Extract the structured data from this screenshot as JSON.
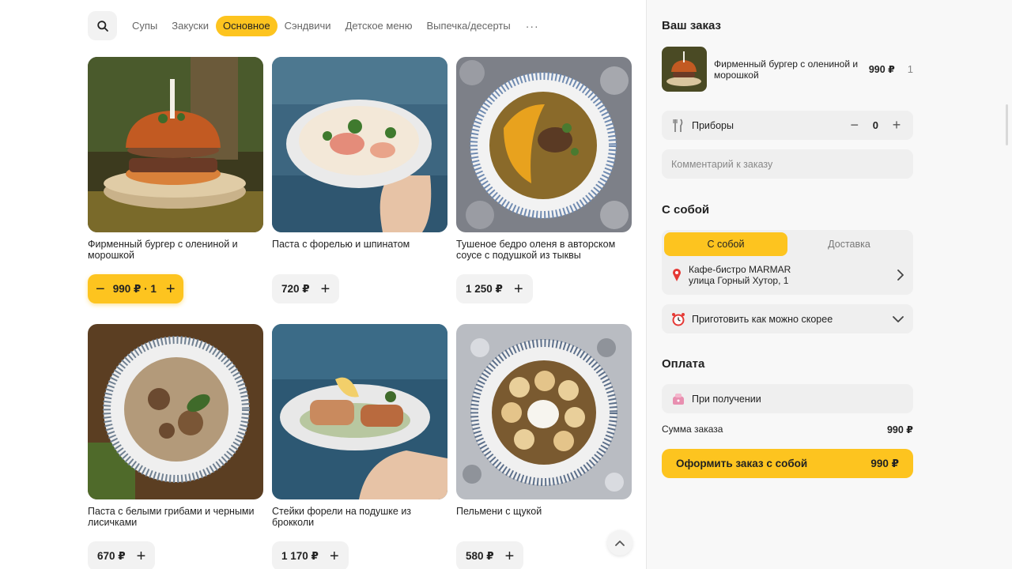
{
  "menu": {
    "categories": [
      "Супы",
      "Закуски",
      "Основное",
      "Сэндвичи",
      "Детское меню",
      "Выпечка/десерты"
    ],
    "active_category": "Основное",
    "more_label": "···",
    "products": [
      {
        "name": "Фирменный бургер с олениной и морошкой",
        "price": "990 ₽",
        "in_cart": true,
        "cart_label": "990 ₽ · 1"
      },
      {
        "name": "Паста с форелью и шпинатом",
        "price": "720 ₽",
        "in_cart": false
      },
      {
        "name": "Тушеное бедро оленя в авторском соусе с подушкой из тыквы",
        "price": "1 250 ₽",
        "in_cart": false
      },
      {
        "name": "Паста с белыми грибами и черными лисичками",
        "price": "670 ₽",
        "in_cart": false
      },
      {
        "name": "Стейки форели на подушке из брокколи",
        "price": "1 170 ₽",
        "in_cart": false
      },
      {
        "name": "Пельмени с щукой",
        "price": "580 ₽",
        "in_cart": false
      }
    ]
  },
  "cart": {
    "title": "Ваш заказ",
    "item": {
      "name": "Фирменный бургер с олениной и морошкой",
      "price": "990 ₽",
      "qty": "1"
    },
    "cutlery": {
      "label": "Приборы",
      "value": "0"
    },
    "comment_placeholder": "Комментарий к заказу",
    "pickup_title": "С собой",
    "tabs": [
      "С собой",
      "Доставка"
    ],
    "active_tab": "С собой",
    "address": {
      "line1": "Кафе-бистро MARMAR",
      "line2": "улица Горный Хутор, 1"
    },
    "time_label": "Приготовить как можно скорее",
    "payment_title": "Оплата",
    "payment_method": "При получении",
    "sum_label": "Сумма заказа",
    "sum_value": "990 ₽",
    "checkout_label": "Оформить заказ с собой",
    "checkout_value": "990 ₽"
  },
  "colors": {
    "accent": "#fdc41f",
    "panel": "#f8f8f8",
    "box": "#efefef"
  },
  "icons": {
    "search": "search-icon",
    "cutlery": "cutlery-icon",
    "location": "map-pin-icon",
    "time": "alarm-clock-icon",
    "payment": "wallet-icon",
    "scroll": "chevron-up-icon"
  }
}
